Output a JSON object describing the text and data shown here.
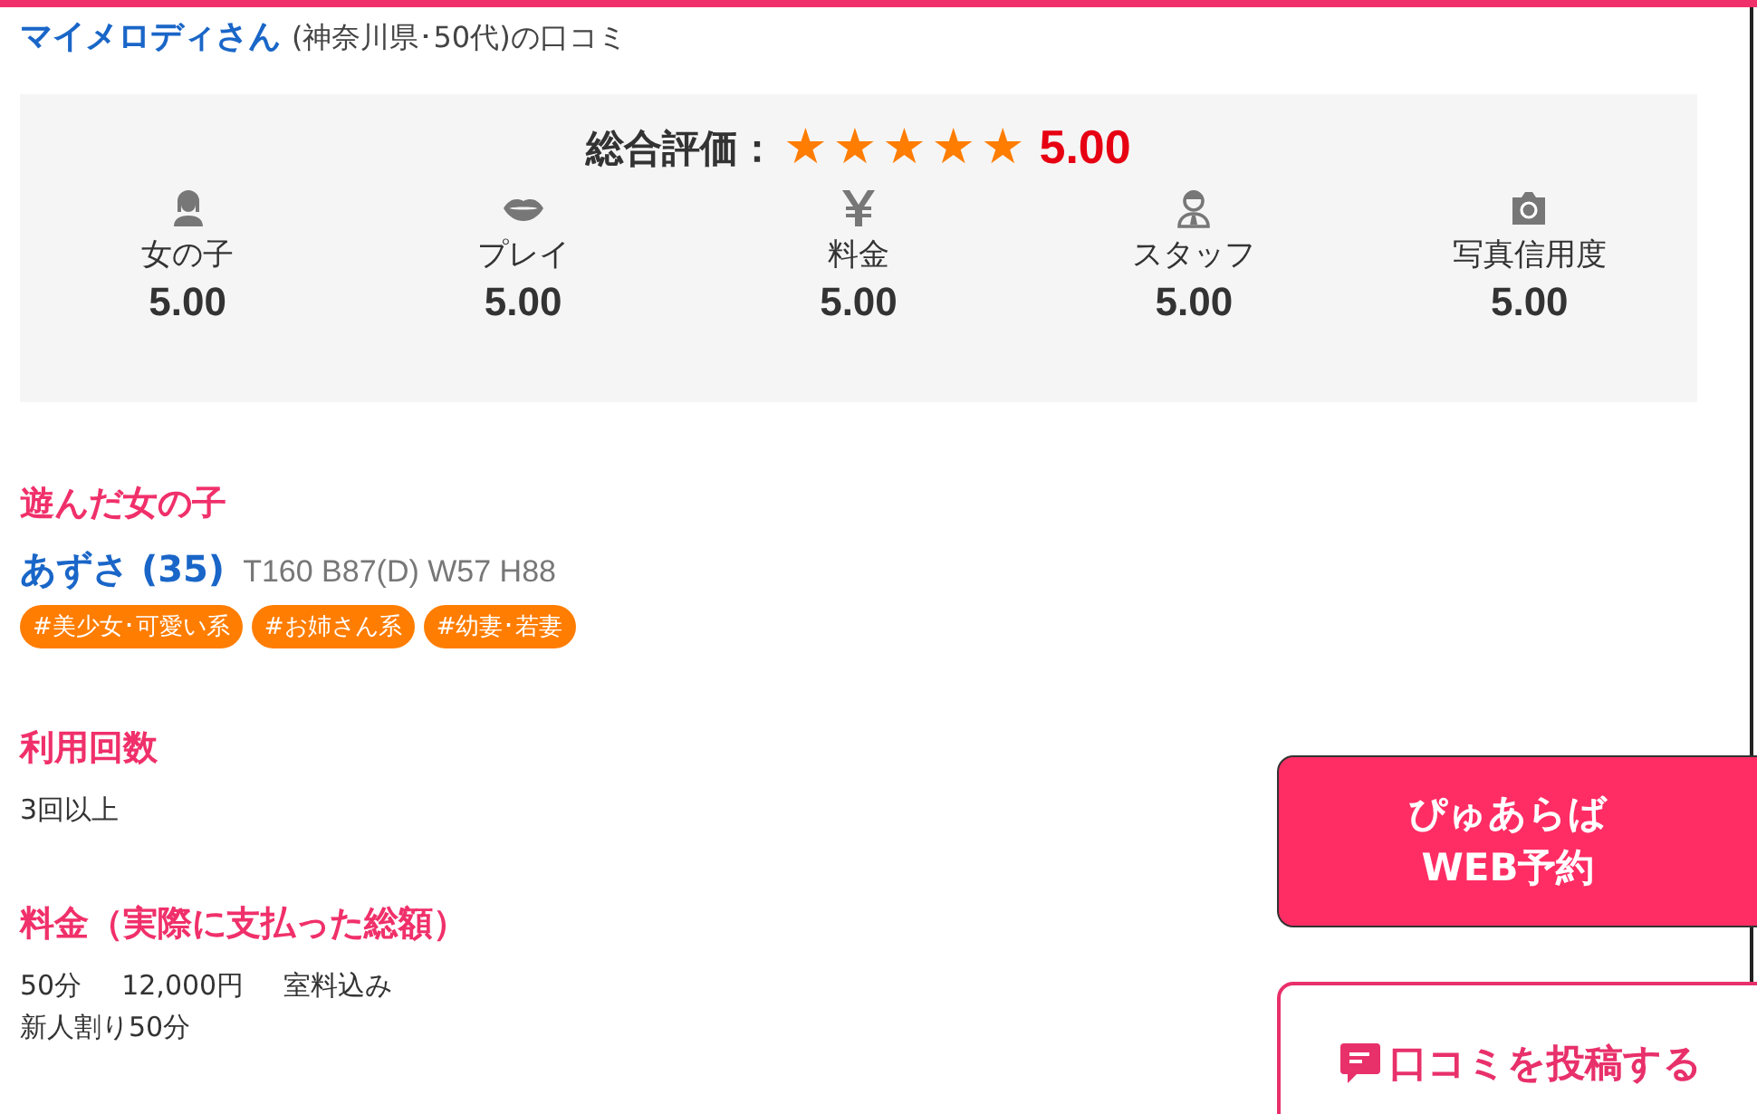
{
  "reviewer": {
    "name": "マイメロディさん",
    "info": "(神奈川県･50代)の口コミ"
  },
  "summary": {
    "label": "総合評価：",
    "stars": 5,
    "score": "5.00",
    "categories": [
      {
        "kind": "girl",
        "label": "女の子",
        "score": "5.00"
      },
      {
        "kind": "lips",
        "label": "プレイ",
        "score": "5.00"
      },
      {
        "kind": "yen",
        "label": "料金",
        "score": "5.00"
      },
      {
        "kind": "staff",
        "label": "スタッフ",
        "score": "5.00"
      },
      {
        "kind": "camera",
        "label": "写真信用度",
        "score": "5.00"
      }
    ]
  },
  "girl_section": {
    "heading": "遊んだ女の子",
    "name": "あずさ (35)",
    "stats": "T160 B87(D) W57 H88",
    "tags": [
      "#美少女･可愛い系",
      "#お姉さん系",
      "#幼妻･若妻"
    ]
  },
  "usage_section": {
    "heading": "利用回数",
    "value": "3回以上"
  },
  "price_section": {
    "heading": "料金（実際に支払った総額）",
    "lines": [
      [
        "50分",
        "12,000円",
        "室料込み"
      ],
      [
        "新人割り50分"
      ]
    ]
  },
  "reserve_button": {
    "line_1": "ぴゅあらば",
    "line_2": "WEB予約"
  },
  "post_button": {
    "label": "口コミを投稿する"
  }
}
